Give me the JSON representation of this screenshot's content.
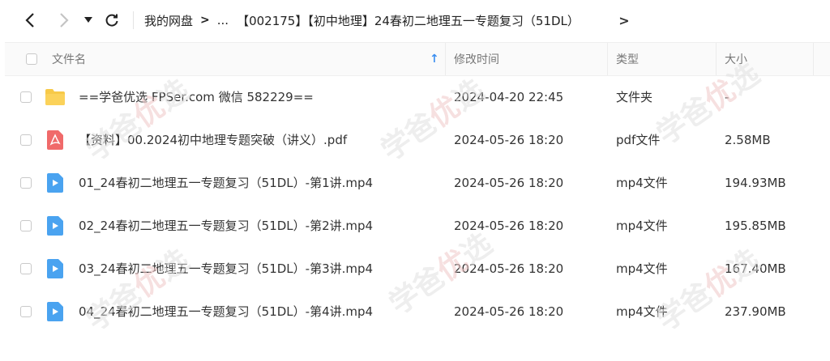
{
  "toolbar": {
    "back_icon": "chevron-left-icon",
    "forward_icon": "chevron-right-icon",
    "dropdown_icon": "caret-down-icon",
    "refresh_icon": "refresh-icon"
  },
  "breadcrumb": {
    "root": "我的网盘",
    "separator": ">",
    "ellipsis": "...",
    "current": "【002175】【初中地理】24春初二地理五一专题复习（51DL）",
    "trailing_arrow": ">"
  },
  "table": {
    "columns": {
      "name": "文件名",
      "sort_icon": "↑",
      "modified": "修改时间",
      "type": "类型",
      "size": "大小"
    },
    "rows": [
      {
        "icon": "folder-icon",
        "name": "==学爸优选 FPSer.com 微信 582229==",
        "modified": "2024-04-20 22:45",
        "type": "文件夹",
        "size": "-"
      },
      {
        "icon": "pdf-icon",
        "name": "【资料】00.2024初中地理专题突破（讲义）.pdf",
        "modified": "2024-05-26 18:20",
        "type": "pdf文件",
        "size": "2.58MB"
      },
      {
        "icon": "video-icon",
        "name": "01_24春初二地理五一专题复习（51DL）-第1讲.mp4",
        "modified": "2024-05-26 18:20",
        "type": "mp4文件",
        "size": "194.93MB"
      },
      {
        "icon": "video-icon",
        "name": "02_24春初二地理五一专题复习（51DL）-第2讲.mp4",
        "modified": "2024-05-26 18:20",
        "type": "mp4文件",
        "size": "195.85MB"
      },
      {
        "icon": "video-icon",
        "name": "03_24春初二地理五一专题复习（51DL）-第3讲.mp4",
        "modified": "2024-05-26 18:20",
        "type": "mp4文件",
        "size": "167.40MB"
      },
      {
        "icon": "video-icon",
        "name": "04_24春初二地理五一专题复习（51DL）-第4讲.mp4",
        "modified": "2024-05-26 18:20",
        "type": "mp4文件",
        "size": "237.90MB"
      }
    ]
  },
  "watermark": {
    "part1": "学爸",
    "part2": "优",
    "part3": "选"
  },
  "colors": {
    "folder": "#f7c948",
    "pdf": "#f06a6a",
    "video": "#4aa3f0",
    "sort_arrow": "#3b8ef0"
  }
}
